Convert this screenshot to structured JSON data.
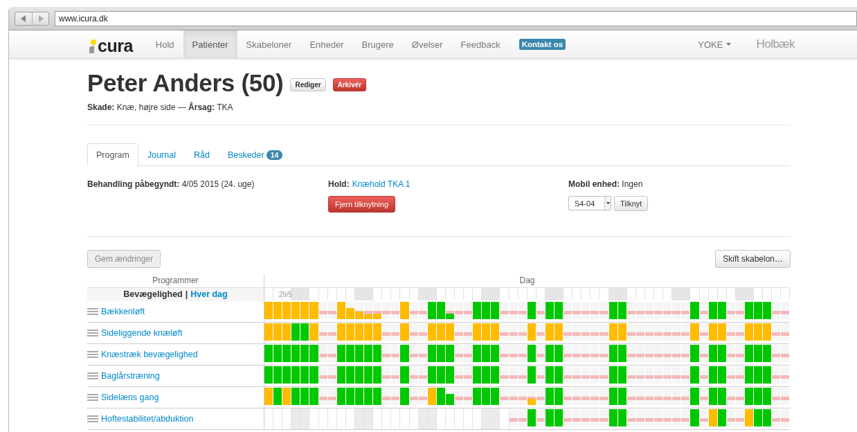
{
  "browser": {
    "url": "www.icura.dk"
  },
  "navbar": {
    "logo": "cura",
    "items": [
      {
        "label": "Hold",
        "selected": false
      },
      {
        "label": "Patienter",
        "selected": true
      },
      {
        "label": "Skabeloner",
        "selected": false
      },
      {
        "label": "Enheder",
        "selected": false
      },
      {
        "label": "Brugere",
        "selected": false
      },
      {
        "label": "Øvelser",
        "selected": false
      },
      {
        "label": "Feedback",
        "selected": false
      }
    ],
    "contact": "Kontakt os",
    "user": "YOKE",
    "site": "Holbæk"
  },
  "patient": {
    "title": "Peter Anders (50)",
    "edit_button": "Rediger",
    "archive_button": "Arkivér",
    "summary": "**Skade:** Knæ, højre side — **Årsag:** TKA"
  },
  "tabs": [
    {
      "label": "Program",
      "selected": true
    },
    {
      "label": "Journal",
      "selected": false
    },
    {
      "label": "Råd",
      "selected": false
    },
    {
      "label": "Beskeder",
      "selected": false,
      "badge": "14"
    }
  ],
  "info": {
    "treatment": "**Behandling påbegyndt:** 4/05 2015 (24. uge)",
    "team_label": "Hold:",
    "team_link": "Knæhold TKA 1",
    "remove_button": "Fjern tilknytning",
    "device": "**Mobil enhed:** Ingen",
    "device_select": "S4-04",
    "attach_button": "Tilknyt"
  },
  "actions": {
    "save_button": "Gem ændringer",
    "save_disabled": true,
    "template_button": "Skift skabelon…"
  },
  "schedule": {
    "programs_heading": "Programmer",
    "days_heading": "Dag",
    "group": "Bevægelighed",
    "separator": "|",
    "frequency": "Hver dag",
    "day_columns": [
      {
        "weekend": false
      },
      {
        "weekend": false,
        "label": "29/5"
      },
      {
        "weekend": false
      },
      {
        "weekend": true
      },
      {
        "weekend": true
      },
      {
        "weekend": false
      },
      {
        "weekend": false
      },
      {
        "weekend": false
      },
      {
        "weekend": false
      },
      {
        "weekend": false
      },
      {
        "weekend": true
      },
      {
        "weekend": true
      },
      {
        "weekend": false
      },
      {
        "weekend": false
      },
      {
        "weekend": false
      },
      {
        "weekend": false
      },
      {
        "weekend": false
      },
      {
        "weekend": true
      },
      {
        "weekend": true
      },
      {
        "weekend": false
      },
      {
        "weekend": false
      },
      {
        "weekend": false
      },
      {
        "weekend": false
      },
      {
        "weekend": false
      },
      {
        "weekend": true
      },
      {
        "weekend": true
      },
      {
        "weekend": false
      },
      {
        "weekend": false
      },
      {
        "weekend": false
      },
      {
        "weekend": false
      },
      {
        "weekend": false
      },
      {
        "weekend": true
      },
      {
        "weekend": true
      },
      {
        "weekend": false
      },
      {
        "weekend": false
      },
      {
        "weekend": false
      },
      {
        "weekend": false
      },
      {
        "weekend": false
      },
      {
        "weekend": true
      },
      {
        "weekend": true
      },
      {
        "weekend": false
      },
      {
        "weekend": false
      },
      {
        "weekend": false
      },
      {
        "weekend": false
      },
      {
        "weekend": false
      },
      {
        "weekend": true
      },
      {
        "weekend": true
      },
      {
        "weekend": false
      },
      {
        "weekend": false
      },
      {
        "weekend": false
      },
      {
        "weekend": false
      },
      {
        "weekend": false
      },
      {
        "weekend": true
      },
      {
        "weekend": true
      },
      {
        "weekend": false
      },
      {
        "weekend": false
      },
      {
        "weekend": false
      },
      {
        "weekend": false
      }
    ],
    "rows": [
      {
        "name": "Bækkenløft",
        "days": [
          {
            "kind": "part"
          },
          {
            "kind": "part"
          },
          {
            "kind": "part"
          },
          {
            "kind": "part"
          },
          {
            "kind": "part"
          },
          {
            "kind": "part"
          },
          {
            "kind": "rest"
          },
          {
            "kind": "rest"
          },
          {
            "kind": "part"
          },
          {
            "kind": "part",
            "level": 0.65
          },
          {
            "kind": "part",
            "level": 0.44
          },
          {
            "kind": "part",
            "level": 0.3
          },
          {
            "kind": "part",
            "level": 0.34
          },
          {
            "kind": "rest"
          },
          {
            "kind": "rest"
          },
          {
            "kind": "part"
          },
          {
            "kind": "rest"
          },
          {
            "kind": "rest"
          },
          {
            "kind": "done"
          },
          {
            "kind": "done"
          },
          {
            "kind": "done",
            "level": 0.32
          },
          {
            "kind": "rest"
          },
          {
            "kind": "rest"
          },
          {
            "kind": "done"
          },
          {
            "kind": "done"
          },
          {
            "kind": "done"
          },
          {
            "kind": "rest"
          },
          {
            "kind": "rest"
          },
          {
            "kind": "rest"
          },
          {
            "kind": "done"
          },
          {
            "kind": "rest"
          },
          {
            "kind": "done"
          },
          {
            "kind": "done"
          },
          {
            "kind": "rest"
          },
          {
            "kind": "rest"
          },
          {
            "kind": "rest"
          },
          {
            "kind": "rest"
          },
          {
            "kind": "rest"
          },
          {
            "kind": "done"
          },
          {
            "kind": "done"
          },
          {
            "kind": "rest"
          },
          {
            "kind": "rest"
          },
          {
            "kind": "rest"
          },
          {
            "kind": "rest"
          },
          {
            "kind": "rest"
          },
          {
            "kind": "rest"
          },
          {
            "kind": "rest"
          },
          {
            "kind": "done"
          },
          {
            "kind": "rest"
          },
          {
            "kind": "done"
          },
          {
            "kind": "done"
          },
          {
            "kind": "rest"
          },
          {
            "kind": "rest"
          },
          {
            "kind": "done"
          },
          {
            "kind": "done"
          },
          {
            "kind": "done"
          },
          {
            "kind": "rest"
          },
          {
            "kind": "rest"
          }
        ]
      },
      {
        "name": "Sideliggende knæløft",
        "days": [
          {
            "kind": "part"
          },
          {
            "kind": "part"
          },
          {
            "kind": "part"
          },
          {
            "kind": "done"
          },
          {
            "kind": "done"
          },
          {
            "kind": "part"
          },
          {
            "kind": "rest"
          },
          {
            "kind": "rest"
          },
          {
            "kind": "part"
          },
          {
            "kind": "part"
          },
          {
            "kind": "part"
          },
          {
            "kind": "part"
          },
          {
            "kind": "part"
          },
          {
            "kind": "rest"
          },
          {
            "kind": "rest"
          },
          {
            "kind": "part"
          },
          {
            "kind": "rest"
          },
          {
            "kind": "rest"
          },
          {
            "kind": "part"
          },
          {
            "kind": "part"
          },
          {
            "kind": "part"
          },
          {
            "kind": "rest"
          },
          {
            "kind": "rest"
          },
          {
            "kind": "part"
          },
          {
            "kind": "part"
          },
          {
            "kind": "part"
          },
          {
            "kind": "rest"
          },
          {
            "kind": "rest"
          },
          {
            "kind": "rest"
          },
          {
            "kind": "part"
          },
          {
            "kind": "rest"
          },
          {
            "kind": "part"
          },
          {
            "kind": "part"
          },
          {
            "kind": "rest"
          },
          {
            "kind": "rest"
          },
          {
            "kind": "rest"
          },
          {
            "kind": "rest"
          },
          {
            "kind": "rest"
          },
          {
            "kind": "part"
          },
          {
            "kind": "part"
          },
          {
            "kind": "rest"
          },
          {
            "kind": "rest"
          },
          {
            "kind": "rest"
          },
          {
            "kind": "rest"
          },
          {
            "kind": "rest"
          },
          {
            "kind": "rest"
          },
          {
            "kind": "rest"
          },
          {
            "kind": "part"
          },
          {
            "kind": "rest"
          },
          {
            "kind": "part"
          },
          {
            "kind": "part"
          },
          {
            "kind": "rest"
          },
          {
            "kind": "rest"
          },
          {
            "kind": "part"
          },
          {
            "kind": "part"
          },
          {
            "kind": "part"
          },
          {
            "kind": "rest"
          },
          {
            "kind": "rest"
          }
        ]
      },
      {
        "name": "Knæstræk bevægelighed",
        "days": [
          {
            "kind": "done"
          },
          {
            "kind": "done"
          },
          {
            "kind": "done"
          },
          {
            "kind": "done"
          },
          {
            "kind": "done"
          },
          {
            "kind": "done"
          },
          {
            "kind": "rest"
          },
          {
            "kind": "rest"
          },
          {
            "kind": "done"
          },
          {
            "kind": "done"
          },
          {
            "kind": "done"
          },
          {
            "kind": "done"
          },
          {
            "kind": "done"
          },
          {
            "kind": "rest"
          },
          {
            "kind": "rest"
          },
          {
            "kind": "done"
          },
          {
            "kind": "rest"
          },
          {
            "kind": "rest"
          },
          {
            "kind": "done"
          },
          {
            "kind": "done"
          },
          {
            "kind": "done"
          },
          {
            "kind": "rest"
          },
          {
            "kind": "rest"
          },
          {
            "kind": "done"
          },
          {
            "kind": "done"
          },
          {
            "kind": "done"
          },
          {
            "kind": "rest"
          },
          {
            "kind": "rest"
          },
          {
            "kind": "rest"
          },
          {
            "kind": "done"
          },
          {
            "kind": "rest"
          },
          {
            "kind": "done"
          },
          {
            "kind": "done"
          },
          {
            "kind": "rest"
          },
          {
            "kind": "rest"
          },
          {
            "kind": "rest"
          },
          {
            "kind": "rest"
          },
          {
            "kind": "rest"
          },
          {
            "kind": "done"
          },
          {
            "kind": "done"
          },
          {
            "kind": "rest"
          },
          {
            "kind": "rest"
          },
          {
            "kind": "rest"
          },
          {
            "kind": "rest"
          },
          {
            "kind": "rest"
          },
          {
            "kind": "rest"
          },
          {
            "kind": "rest"
          },
          {
            "kind": "done"
          },
          {
            "kind": "rest"
          },
          {
            "kind": "done"
          },
          {
            "kind": "done"
          },
          {
            "kind": "rest"
          },
          {
            "kind": "rest"
          },
          {
            "kind": "done"
          },
          {
            "kind": "done"
          },
          {
            "kind": "done"
          },
          {
            "kind": "rest"
          },
          {
            "kind": "rest"
          }
        ]
      },
      {
        "name": "Baglårstræning",
        "days": [
          {
            "kind": "done"
          },
          {
            "kind": "done"
          },
          {
            "kind": "done"
          },
          {
            "kind": "done"
          },
          {
            "kind": "done"
          },
          {
            "kind": "done"
          },
          {
            "kind": "rest"
          },
          {
            "kind": "rest"
          },
          {
            "kind": "done"
          },
          {
            "kind": "done"
          },
          {
            "kind": "done"
          },
          {
            "kind": "done"
          },
          {
            "kind": "done"
          },
          {
            "kind": "rest"
          },
          {
            "kind": "rest"
          },
          {
            "kind": "done"
          },
          {
            "kind": "rest"
          },
          {
            "kind": "rest"
          },
          {
            "kind": "done"
          },
          {
            "kind": "done"
          },
          {
            "kind": "done"
          },
          {
            "kind": "rest"
          },
          {
            "kind": "rest"
          },
          {
            "kind": "done"
          },
          {
            "kind": "done"
          },
          {
            "kind": "done"
          },
          {
            "kind": "rest"
          },
          {
            "kind": "rest"
          },
          {
            "kind": "rest"
          },
          {
            "kind": "done"
          },
          {
            "kind": "rest"
          },
          {
            "kind": "done"
          },
          {
            "kind": "done"
          },
          {
            "kind": "rest"
          },
          {
            "kind": "rest"
          },
          {
            "kind": "rest"
          },
          {
            "kind": "rest"
          },
          {
            "kind": "rest"
          },
          {
            "kind": "done"
          },
          {
            "kind": "done"
          },
          {
            "kind": "rest"
          },
          {
            "kind": "rest"
          },
          {
            "kind": "rest"
          },
          {
            "kind": "rest"
          },
          {
            "kind": "rest"
          },
          {
            "kind": "rest"
          },
          {
            "kind": "rest"
          },
          {
            "kind": "done"
          },
          {
            "kind": "rest"
          },
          {
            "kind": "done"
          },
          {
            "kind": "done"
          },
          {
            "kind": "rest"
          },
          {
            "kind": "rest"
          },
          {
            "kind": "done"
          },
          {
            "kind": "done"
          },
          {
            "kind": "done"
          },
          {
            "kind": "rest"
          },
          {
            "kind": "rest"
          }
        ]
      },
      {
        "name": "Sidelæns gang",
        "days": [
          {
            "kind": "part"
          },
          {
            "kind": "done"
          },
          {
            "kind": "part"
          },
          {
            "kind": "done"
          },
          {
            "kind": "done"
          },
          {
            "kind": "done"
          },
          {
            "kind": "rest"
          },
          {
            "kind": "rest"
          },
          {
            "kind": "done"
          },
          {
            "kind": "done"
          },
          {
            "kind": "done"
          },
          {
            "kind": "done"
          },
          {
            "kind": "done"
          },
          {
            "kind": "rest"
          },
          {
            "kind": "rest"
          },
          {
            "kind": "done"
          },
          {
            "kind": "rest"
          },
          {
            "kind": "rest"
          },
          {
            "kind": "part"
          },
          {
            "kind": "done"
          },
          {
            "kind": "done",
            "level": 0.65
          },
          {
            "kind": "rest"
          },
          {
            "kind": "rest"
          },
          {
            "kind": "done"
          },
          {
            "kind": "done"
          },
          {
            "kind": "done"
          },
          {
            "kind": "rest"
          },
          {
            "kind": "rest"
          },
          {
            "kind": "rest"
          },
          {
            "kind": "part",
            "level": 0.38
          },
          {
            "kind": "rest"
          },
          {
            "kind": "done"
          },
          {
            "kind": "done"
          },
          {
            "kind": "rest"
          },
          {
            "kind": "rest"
          },
          {
            "kind": "rest"
          },
          {
            "kind": "rest"
          },
          {
            "kind": "rest"
          },
          {
            "kind": "done"
          },
          {
            "kind": "done"
          },
          {
            "kind": "rest"
          },
          {
            "kind": "rest"
          },
          {
            "kind": "rest"
          },
          {
            "kind": "rest"
          },
          {
            "kind": "rest"
          },
          {
            "kind": "rest"
          },
          {
            "kind": "rest"
          },
          {
            "kind": "done"
          },
          {
            "kind": "rest"
          },
          {
            "kind": "done"
          },
          {
            "kind": "done"
          },
          {
            "kind": "rest"
          },
          {
            "kind": "rest"
          },
          {
            "kind": "done"
          },
          {
            "kind": "done"
          },
          {
            "kind": "done"
          },
          {
            "kind": "rest"
          },
          {
            "kind": "rest"
          }
        ]
      },
      {
        "name": "Hoftestabilitet/abduktion",
        "days": [
          {
            "kind": "none"
          },
          {
            "kind": "none"
          },
          {
            "kind": "none"
          },
          {
            "kind": "none"
          },
          {
            "kind": "none"
          },
          {
            "kind": "none"
          },
          {
            "kind": "none"
          },
          {
            "kind": "none"
          },
          {
            "kind": "none"
          },
          {
            "kind": "none"
          },
          {
            "kind": "none"
          },
          {
            "kind": "none"
          },
          {
            "kind": "none"
          },
          {
            "kind": "none"
          },
          {
            "kind": "none"
          },
          {
            "kind": "none"
          },
          {
            "kind": "none"
          },
          {
            "kind": "none"
          },
          {
            "kind": "none"
          },
          {
            "kind": "none"
          },
          {
            "kind": "none"
          },
          {
            "kind": "none"
          },
          {
            "kind": "none"
          },
          {
            "kind": "none"
          },
          {
            "kind": "none"
          },
          {
            "kind": "none"
          },
          {
            "kind": "none"
          },
          {
            "kind": "rest"
          },
          {
            "kind": "rest"
          },
          {
            "kind": "done"
          },
          {
            "kind": "rest"
          },
          {
            "kind": "done"
          },
          {
            "kind": "done"
          },
          {
            "kind": "rest"
          },
          {
            "kind": "rest"
          },
          {
            "kind": "rest"
          },
          {
            "kind": "rest"
          },
          {
            "kind": "rest"
          },
          {
            "kind": "done"
          },
          {
            "kind": "done"
          },
          {
            "kind": "rest"
          },
          {
            "kind": "rest"
          },
          {
            "kind": "rest"
          },
          {
            "kind": "rest"
          },
          {
            "kind": "rest"
          },
          {
            "kind": "rest"
          },
          {
            "kind": "rest"
          },
          {
            "kind": "done"
          },
          {
            "kind": "rest"
          },
          {
            "kind": "part"
          },
          {
            "kind": "done"
          },
          {
            "kind": "rest"
          },
          {
            "kind": "rest"
          },
          {
            "kind": "part"
          },
          {
            "kind": "done"
          },
          {
            "kind": "done"
          },
          {
            "kind": "rest"
          },
          {
            "kind": "rest"
          }
        ]
      }
    ]
  }
}
